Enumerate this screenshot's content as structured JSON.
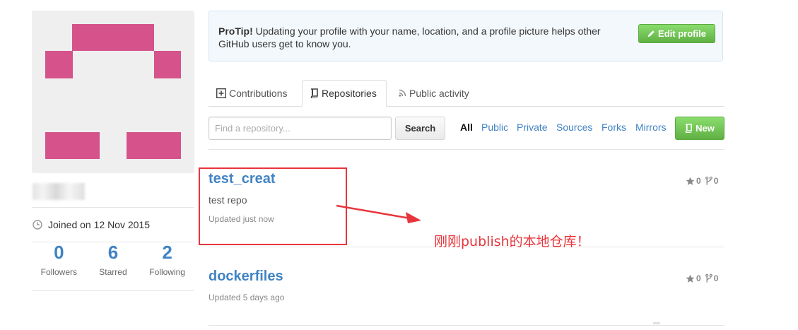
{
  "protip": {
    "label": "ProTip!",
    "text": "Updating your profile with your name, location, and a profile picture helps other GitHub users get to know you.",
    "edit_button": "Edit profile"
  },
  "profile": {
    "joined": "Joined on 12 Nov 2015",
    "stats": [
      {
        "count": "0",
        "label": "Followers"
      },
      {
        "count": "6",
        "label": "Starred"
      },
      {
        "count": "2",
        "label": "Following"
      }
    ]
  },
  "tabs": [
    {
      "label": "Contributions",
      "icon": "plus-square-icon"
    },
    {
      "label": "Repositories",
      "icon": "repo-book-icon",
      "active": true
    },
    {
      "label": "Public activity",
      "icon": "rss-icon"
    }
  ],
  "filter_bar": {
    "search_placeholder": "Find a repository...",
    "search_button": "Search",
    "filters": [
      "All",
      "Public",
      "Private",
      "Sources",
      "Forks",
      "Mirrors"
    ],
    "selected_filter": "All",
    "new_button": "New"
  },
  "repositories": [
    {
      "name": "test_creat",
      "description": "test repo",
      "updated": "Updated just now",
      "stars": "0",
      "forks": "0"
    },
    {
      "name": "dockerfiles",
      "description": "",
      "updated": "Updated 5 days ago",
      "stars": "0",
      "forks": "0"
    }
  ],
  "annotation": {
    "text": "刚刚publish的本地仓库！",
    "color": "#e8343b"
  },
  "colors": {
    "link": "#4183c4",
    "avatar_pink": "#d5538a",
    "button_green": "#60b044"
  }
}
